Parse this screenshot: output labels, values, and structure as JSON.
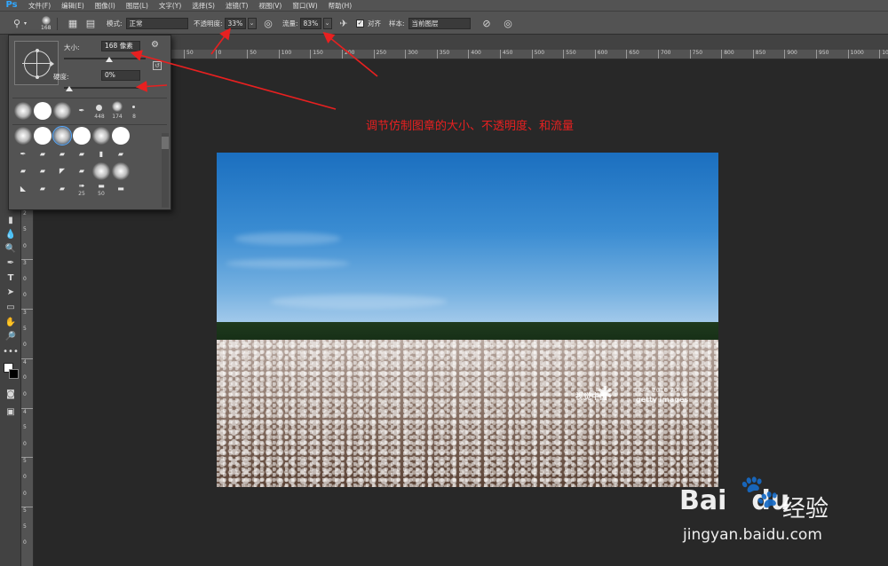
{
  "app": {
    "logo": "Ps"
  },
  "menu": [
    "文件(F)",
    "编辑(E)",
    "图像(I)",
    "图层(L)",
    "文字(Y)",
    "选择(S)",
    "滤镜(T)",
    "视图(V)",
    "窗口(W)",
    "帮助(H)"
  ],
  "options": {
    "brush_size": "168",
    "mode_label": "模式:",
    "mode_value": "正常",
    "opacity_label": "不透明度:",
    "opacity_value": "33%",
    "flow_label": "流量:",
    "flow_value": "83%",
    "align_label": "对齐",
    "sample_label": "样本:",
    "sample_value": "当前图层"
  },
  "brush_panel": {
    "size_label": "大小:",
    "size_value": "168 像素",
    "size_level": 0.55,
    "hardness_label": "硬度:",
    "hardness_value": "0%",
    "hardness_level": 0.0,
    "recent_numbers": [
      "448",
      "174",
      "8"
    ],
    "preset_numbers": [
      "25",
      "50"
    ]
  },
  "ruler": {
    "top_ticks": [
      "50",
      "0",
      "50",
      "100",
      "150",
      "200",
      "250",
      "300",
      "350",
      "400",
      "450",
      "500",
      "550",
      "600",
      "650",
      "700",
      "750",
      "800",
      "850",
      "900",
      "950",
      "1000",
      "1050"
    ],
    "left_ticks": [
      "1",
      "5",
      "0",
      "1",
      "0",
      "0",
      "2",
      "0",
      "0",
      "2",
      "5",
      "0",
      "3",
      "0",
      "0",
      "3",
      "5",
      "0",
      "4",
      "0",
      "0",
      "4",
      "5",
      "0",
      "5",
      "0",
      "0",
      "5",
      "5",
      "0"
    ]
  },
  "annotation": {
    "text": "调节仿制图章的大小、不透明度、和流量",
    "color": "#e82020"
  },
  "photo_watermark": {
    "brand": "视觉中国",
    "id": "TRAS 2016 70 88",
    "getty": "getty images"
  },
  "baidu": {
    "logo_text": "Bai",
    "logo_text2": "du",
    "logo_cn": "经验",
    "url": "jingyan.baidu.com"
  },
  "colors": {
    "accent": "#31a8ff",
    "panel": "#535353",
    "canvas_bg": "#282828",
    "annotation": "#e82020"
  }
}
